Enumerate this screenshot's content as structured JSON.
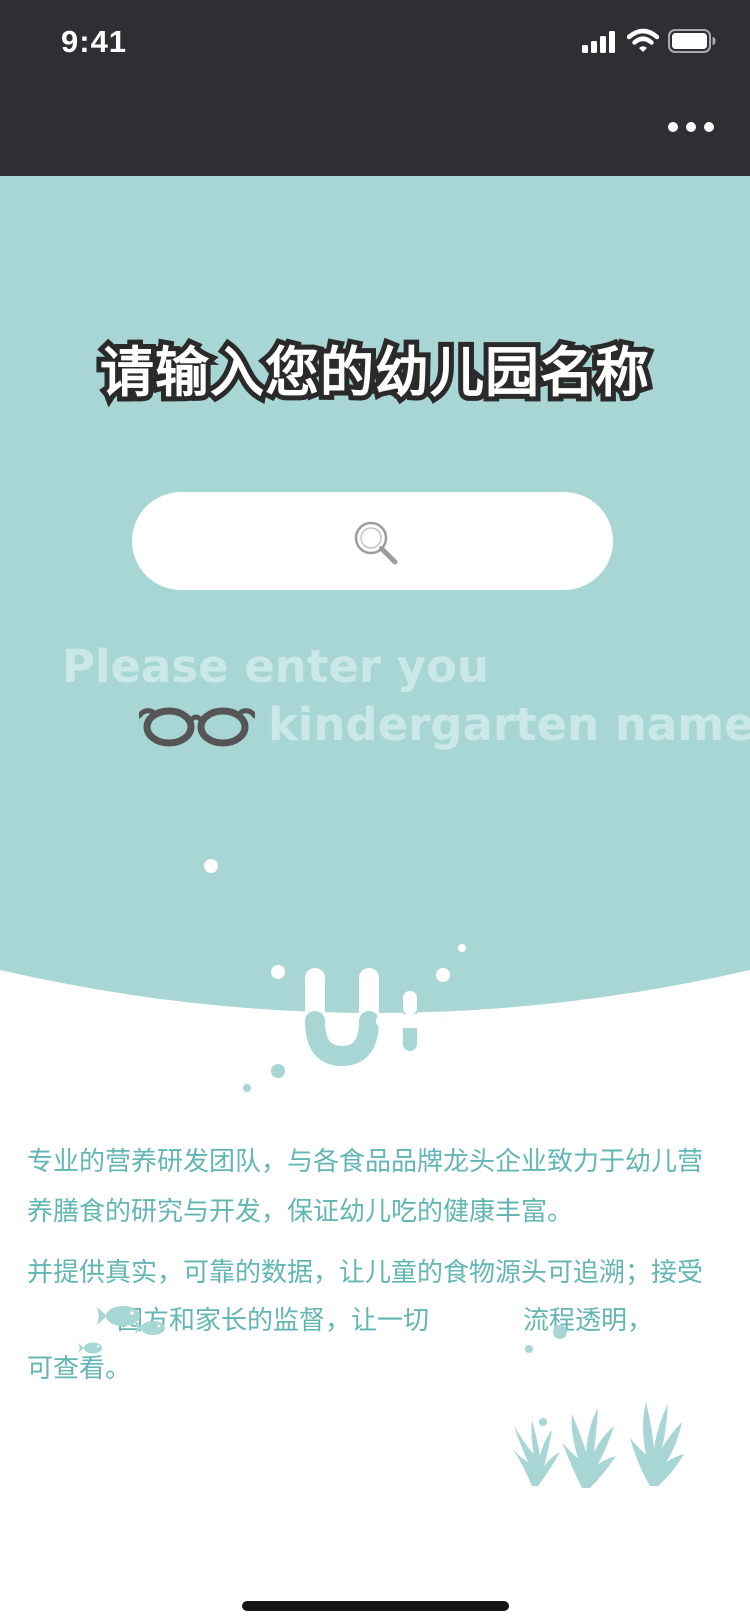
{
  "status_bar": {
    "time": "9:41",
    "icons": [
      "signal-icon",
      "wifi-icon",
      "battery-icon"
    ]
  },
  "nav": {
    "more_icon": "more-icon"
  },
  "hero": {
    "title": "请输入您的幼儿园名称",
    "search": {
      "value": "",
      "placeholder": "",
      "icon": "search-icon"
    },
    "hint_line1": "Please enter you",
    "hint_line2": "kindergarten name",
    "logo": "U+"
  },
  "description": {
    "p1": "专业的营养研发团队，与各食品品牌龙头企业致力于幼儿营养膳食的研究与开发，保证幼儿吃的健康丰富。",
    "p2_a": "并提供真实，可靠的数据，让儿童的食物源头可追溯；接受",
    "p2_b": "园方和家长的监督，让一切",
    "p2_c": "流程透明，",
    "p2_d": "可查看。"
  },
  "colors": {
    "header": "#2f2e33",
    "hero": "#a8d6d5",
    "accent_text": "#62b6b3",
    "hint_text": "#cae8e7",
    "background": "#ffffff"
  }
}
